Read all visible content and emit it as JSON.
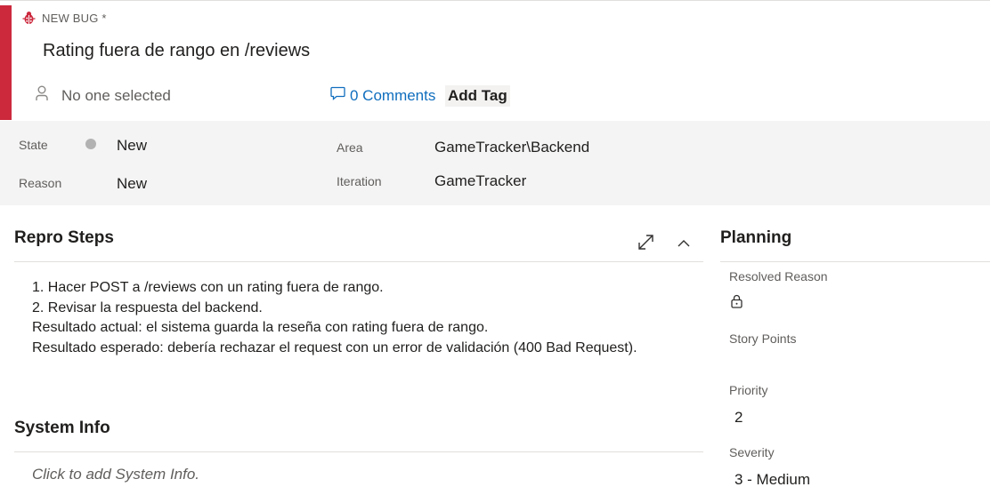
{
  "header": {
    "work_item_type": "NEW BUG *",
    "title": "Rating fuera de rango en /reviews",
    "assigned_to": "No one selected",
    "comments_label": "0 Comments",
    "add_tag_label": "Add Tag",
    "accent_color": "#cc293d",
    "link_color": "#106ebe"
  },
  "fields": {
    "state_label": "State",
    "state_value": "New",
    "reason_label": "Reason",
    "reason_value": "New",
    "area_label": "Area",
    "area_value": "GameTracker\\Backend",
    "iteration_label": "Iteration",
    "iteration_value": "GameTracker"
  },
  "repro_steps": {
    "title": "Repro Steps",
    "lines": [
      "1. Hacer POST a /reviews con un rating fuera de rango.",
      "2. Revisar la respuesta del backend.",
      "",
      "Resultado actual: el sistema guarda la reseña con rating fuera de rango.",
      "Resultado esperado: debería rechazar el request con un error de validación (400 Bad Request)."
    ]
  },
  "system_info": {
    "title": "System Info",
    "placeholder": "Click to add System Info."
  },
  "planning": {
    "title": "Planning",
    "resolved_reason_label": "Resolved Reason",
    "story_points_label": "Story Points",
    "priority_label": "Priority",
    "priority_value": "2",
    "severity_label": "Severity",
    "severity_value": "3 - Medium"
  },
  "icons": {
    "work_item": "bug-icon",
    "assigned": "person-icon",
    "comments": "comment-icon",
    "expand": "expand-icon",
    "collapse": "chevron-up-icon",
    "locked": "lock-icon"
  }
}
